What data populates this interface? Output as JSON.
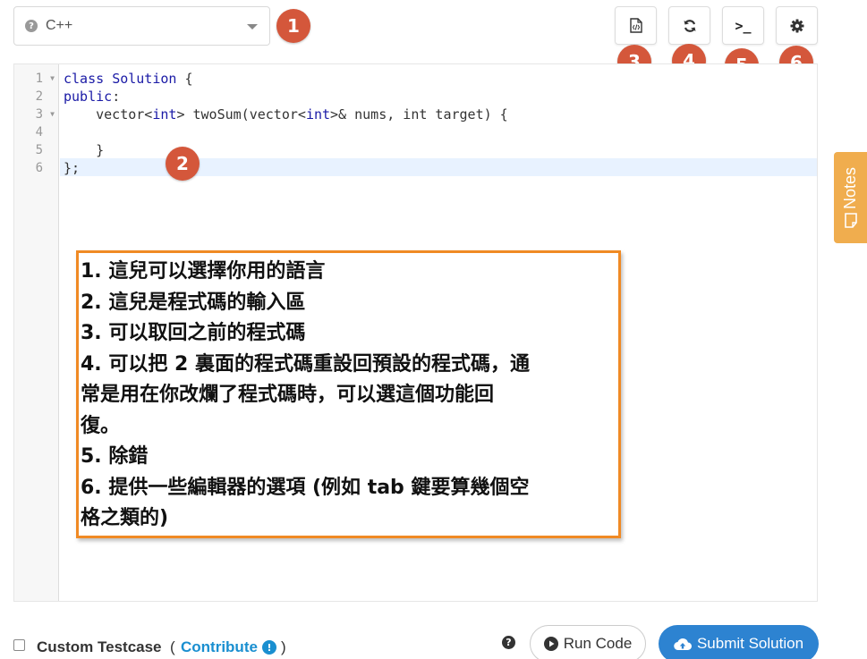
{
  "language_select": {
    "value": "C++",
    "help_icon": "question-circle-icon"
  },
  "markers": [
    "1",
    "2",
    "3",
    "4",
    "5",
    "6"
  ],
  "toolbar": {
    "buttons": [
      {
        "name": "retrieve-code-button",
        "icon": "file-code-icon"
      },
      {
        "name": "reset-code-button",
        "icon": "refresh-icon"
      },
      {
        "name": "console-button",
        "icon": "terminal-icon",
        "glyph": ">_"
      },
      {
        "name": "settings-button",
        "icon": "gear-icon"
      }
    ]
  },
  "editor": {
    "line_numbers": [
      "1",
      "2",
      "3",
      "4",
      "5",
      "6"
    ],
    "lines": [
      {
        "kw1": "class",
        "rest1": " ",
        "ty1": "Solution",
        "rest2": " {"
      },
      {
        "kw1": "public",
        "rest1": ":"
      },
      {
        "pre": "    vector<",
        "kw1": "int",
        "mid": "> twoSum(vector<",
        "kw2": "int",
        "rest1": ">& nums, int target) {"
      },
      {
        "text": ""
      },
      {
        "text": "    }"
      },
      {
        "text": "};"
      }
    ]
  },
  "notes_tab": {
    "label": "Notes"
  },
  "annotation": {
    "lines": [
      "1. 這兒可以選擇你用的語言",
      "2. 這兒是程式碼的輸入區",
      "3. 可以取回之前的程式碼",
      "4. 可以把 2 裏面的程式碼重設回預設的程式碼，通",
      "常是用在你改爛了程式碼時，可以選這個功能回",
      "復。",
      "5. 除錯",
      "6. 提供一些編輯器的選項 (例如 tab 鍵要算幾個空",
      "格之類的)"
    ]
  },
  "bottom": {
    "custom_testcase": "Custom Testcase",
    "paren_open": "(",
    "contribute": "Contribute",
    "paren_close": ")",
    "run_code": "Run Code",
    "submit": "Submit Solution"
  },
  "colors": {
    "marker": "#d4573b",
    "notes_tab": "#f0ad4e",
    "annotation_border": "#f08a24",
    "submit": "#2d83d1",
    "link": "#1a8fd0"
  }
}
